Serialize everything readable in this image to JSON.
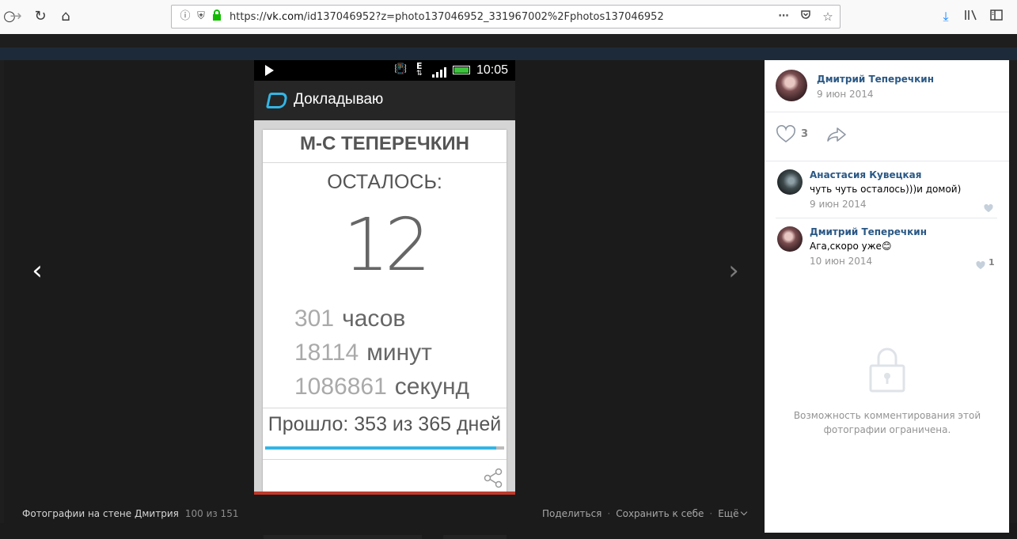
{
  "browser": {
    "url_prefix": "https://",
    "url_host": "vk.com",
    "url_path": "/id137046952?z=photo137046952_331967002%2Fphotos137046952",
    "icons": {
      "back": "back-arrow-icon",
      "forward": "forward-arrow-icon",
      "reload": "reload-icon",
      "home": "home-icon",
      "info": "info-icon",
      "shield": "tracking-shield-icon",
      "lock": "padlock-icon",
      "more": "more-dots-icon",
      "pocket": "pocket-icon",
      "bookmark": "star-icon",
      "download": "download-icon",
      "library": "library-icon",
      "sidebar": "sidebar-icon"
    }
  },
  "phone": {
    "time": "10:05",
    "network": "E",
    "app_title": "Докладываю",
    "name": "М-С ТЕПЕРЕЧКИН",
    "left_label": "ОСТАЛОСЬ:",
    "days_left": "12",
    "units": [
      {
        "value": "301",
        "word": "часов"
      },
      {
        "value": "18114",
        "word": "минут"
      },
      {
        "value": "1086861",
        "word": "секунд"
      }
    ],
    "passed_text": "Прошло: 353 из 365 дней",
    "progress_fraction": 0.967,
    "colors": {
      "accent": "#33b5e5",
      "battery": "#3cc23c",
      "bottom_line": "#c0392b"
    }
  },
  "viewer": {
    "caption": "Фотографии на стене Дмитрия",
    "count": "100 из 151",
    "share": "Поделиться",
    "save": "Сохранить к себе",
    "more": "Ещё"
  },
  "sidebar": {
    "owner_name": "Дмитрий Теперечкин",
    "owner_date": "9 июн 2014",
    "likes": "3",
    "comments": [
      {
        "author": "Анастасия Кувецкая",
        "text": "чуть чуть осталось)))и домой)",
        "date": "9 июн 2014",
        "likes": ""
      },
      {
        "author": "Дмитрий Теперечкин",
        "text": "Ага,скоро уже😊",
        "date": "10 июн 2014",
        "likes": "1"
      }
    ],
    "restriction": "Возможность комментирования этой фотографии ограничена.",
    "colors": {
      "link": "#2a5885",
      "muted": "#939393"
    }
  }
}
